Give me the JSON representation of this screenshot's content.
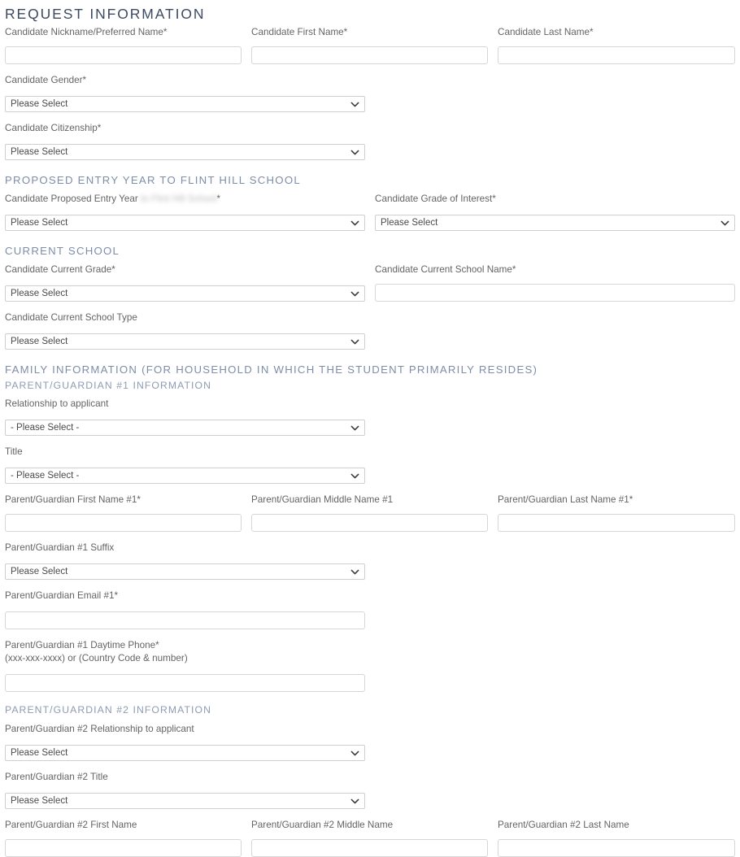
{
  "headings": {
    "request_information": "REQUEST INFORMATION",
    "proposed_entry_year": "PROPOSED ENTRY YEAR TO FLINT HILL SCHOOL",
    "current_school": "CURRENT SCHOOL",
    "family_information": "FAMILY INFORMATION (FOR HOUSEHOLD IN WHICH THE STUDENT PRIMARILY RESIDES)",
    "parent_guardian_1": "PARENT/GUARDIAN #1 INFORMATION",
    "parent_guardian_2": "PARENT/GUARDIAN #2 INFORMATION"
  },
  "placeholder_select": "Please Select",
  "placeholder_select_dashed": "- Please Select -",
  "colors": {
    "heading_main": "#3e4a61",
    "heading_section": "#7e8da8",
    "heading_sub": "#8e9bb2",
    "label": "#646464",
    "input_border": "#d6d6d6",
    "select_border": "#cfcfcf",
    "select_text": "#4a4a4a",
    "page_background": "#ffffff"
  },
  "request_information": {
    "nickname": {
      "label": "Candidate Nickname/Preferred Name*",
      "value": ""
    },
    "first_name": {
      "label": "Candidate First Name*",
      "value": ""
    },
    "last_name": {
      "label": "Candidate Last Name*",
      "value": ""
    },
    "gender": {
      "label": "Candidate Gender*",
      "value": "Please Select"
    },
    "citizenship": {
      "label": "Candidate Citizenship*",
      "value": "Please Select"
    }
  },
  "proposed_entry_year": {
    "entry_year": {
      "label_prefix": "Candidate Proposed Entry Year ",
      "label_redacted": "to Flint Hill School",
      "label_suffix": "*",
      "value": "Please Select"
    },
    "grade_of_interest": {
      "label": "Candidate Grade of Interest*",
      "value": "Please Select"
    }
  },
  "current_school": {
    "current_grade": {
      "label": "Candidate Current Grade*",
      "value": "Please Select"
    },
    "current_school_name": {
      "label": "Candidate Current School Name*",
      "value": ""
    },
    "current_school_type": {
      "label": "Candidate Current School Type",
      "value": "Please Select"
    }
  },
  "parent_guardian_1": {
    "relationship": {
      "label": "Relationship to applicant",
      "value": "- Please Select -"
    },
    "title": {
      "label": "Title",
      "value": "- Please Select -"
    },
    "first_name": {
      "label": "Parent/Guardian First Name #1*",
      "value": ""
    },
    "middle_name": {
      "label": "Parent/Guardian Middle Name #1",
      "value": ""
    },
    "last_name": {
      "label": "Parent/Guardian Last Name #1*",
      "value": ""
    },
    "suffix": {
      "label": "Parent/Guardian #1 Suffix",
      "value": "Please Select"
    },
    "email": {
      "label": "Parent/Guardian Email #1*",
      "value": ""
    },
    "phone": {
      "label": "Parent/Guardian #1 Daytime Phone*",
      "hint": "(xxx-xxx-xxxx) or (Country Code & number)",
      "value": ""
    }
  },
  "parent_guardian_2": {
    "relationship": {
      "label": "Parent/Guardian #2 Relationship to applicant",
      "value": "Please Select"
    },
    "title": {
      "label": "Parent/Guardian #2 Title",
      "value": "Please Select"
    },
    "first_name": {
      "label": "Parent/Guardian #2 First Name",
      "value": ""
    },
    "middle_name": {
      "label": "Parent/Guardian #2 Middle Name",
      "value": ""
    },
    "last_name": {
      "label": "Parent/Guardian #2 Last Name",
      "value": ""
    }
  }
}
